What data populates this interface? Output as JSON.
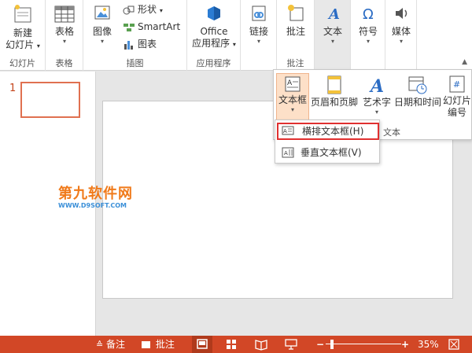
{
  "ribbon": {
    "new_slide": {
      "line1": "新建",
      "line2": "幻灯片",
      "caret": "▾"
    },
    "table": {
      "label": "表格",
      "caret": "▾"
    },
    "image": {
      "label": "图像",
      "caret": "▾"
    },
    "shapes": {
      "label": "形状",
      "caret": "▾"
    },
    "smartart": {
      "label": "SmartArt"
    },
    "chart": {
      "label": "图表"
    },
    "office": {
      "line1": "Office",
      "line2": "应用程序",
      "caret": "▾"
    },
    "link": {
      "label": "链接",
      "caret": "▾"
    },
    "comment": {
      "label": "批注"
    },
    "text": {
      "label": "文本",
      "caret": "▾"
    },
    "symbol": {
      "label": "符号",
      "caret": "▾"
    },
    "media": {
      "label": "媒体",
      "caret": "▾"
    },
    "groups": {
      "slides": "幻灯片",
      "tables": "表格",
      "illustrations": "插图",
      "apps": "应用程序",
      "comments": "批注"
    },
    "collapse_glyph": "▲"
  },
  "text_panel": {
    "textbox": {
      "label": "文本框",
      "caret": "▾"
    },
    "header_footer": {
      "label": "页眉和页脚"
    },
    "wordart": {
      "label": "艺术字",
      "caret": "▾"
    },
    "datetime": {
      "label": "日期和时间"
    },
    "slide_number": {
      "line1": "幻灯片",
      "line2": "编号"
    },
    "group_label": "文本"
  },
  "textbox_menu": {
    "horizontal": "横排文本框(H)",
    "vertical": "垂直文本框(V)"
  },
  "thumbnails": {
    "slide_number": "1"
  },
  "watermark": {
    "title": "第九软件网",
    "url": "WWW.D9SOFT.COM"
  },
  "status": {
    "notes": "备注",
    "comments": "批注",
    "zoom": "35%"
  },
  "colors": {
    "accent": "#d24726",
    "menu_highlight": "#e03030"
  }
}
